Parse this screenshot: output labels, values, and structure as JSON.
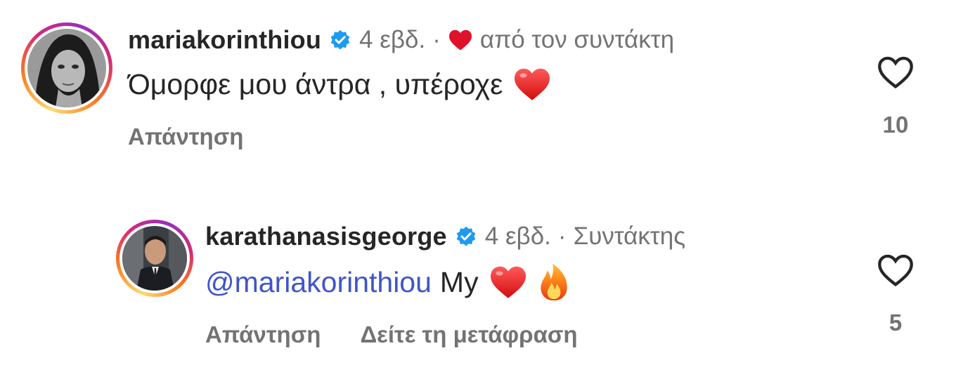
{
  "comments": [
    {
      "username": "mariakorinthiou",
      "time": "4 εβδ.",
      "separator": "·",
      "meta_label": "από τον συντάκτη",
      "text": "Όμορφε μου άντρα , υπέροχε",
      "actions": [
        "Απάντηση"
      ],
      "like_count": "10",
      "avatar_icon": "avatar-woman-bw"
    },
    {
      "username": "karathanasisgeorge",
      "time": "4 εβδ.",
      "separator": "·",
      "meta_label": "Συντάκτης",
      "mention": "@mariakorinthiou",
      "text": "My",
      "actions": [
        "Απάντηση",
        "Δείτε τη μετάφραση"
      ],
      "like_count": "5",
      "avatar_icon": "avatar-man-suit"
    }
  ],
  "colors": {
    "verified": "#1d9bf0",
    "heart": "#e0112b",
    "mention": "#3f55c9",
    "secondary_text": "#737373"
  }
}
